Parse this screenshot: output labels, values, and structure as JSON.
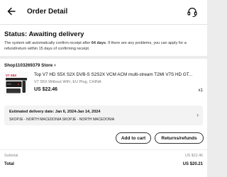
{
  "header": {
    "title": "Order Detail"
  },
  "status": {
    "title": "Status: Awaiting delivery",
    "desc_prefix": "The system will automatically confirm receipt after ",
    "desc_days": "64 days",
    "desc_suffix": ". If there are any problems, you can apply for a refund/return within 15 days of confirming receipt."
  },
  "shop": {
    "name": "Shop1103269379 Store"
  },
  "product": {
    "name": "Top V7 HD S5X S2X DVB-S S2S2X VCM ACM multi-stream T2MI V7S HD GT...",
    "variant": "V7 S5X Without WiFi, EU Plug, CHINA",
    "price": "US $22.46",
    "quantity": "x1"
  },
  "delivery": {
    "estimate": "Estimated delivery date: Jan 6, 2024-Jan 14, 2024",
    "address": "SKOPJE - NORTH MACEDONIA SKOPJE - NORTH MACEDONIA"
  },
  "actions": {
    "add_to_cart": "Add to cart",
    "returns": "Returns/refunds"
  },
  "summary": {
    "subtotal_label": "Subtotal",
    "subtotal_value": "US $22.46",
    "total_label": "Total",
    "total_value": "US $20.21"
  },
  "colors": {
    "background": "#ececec",
    "card": "#ffffff",
    "text": "#111111",
    "muted": "#777777"
  }
}
